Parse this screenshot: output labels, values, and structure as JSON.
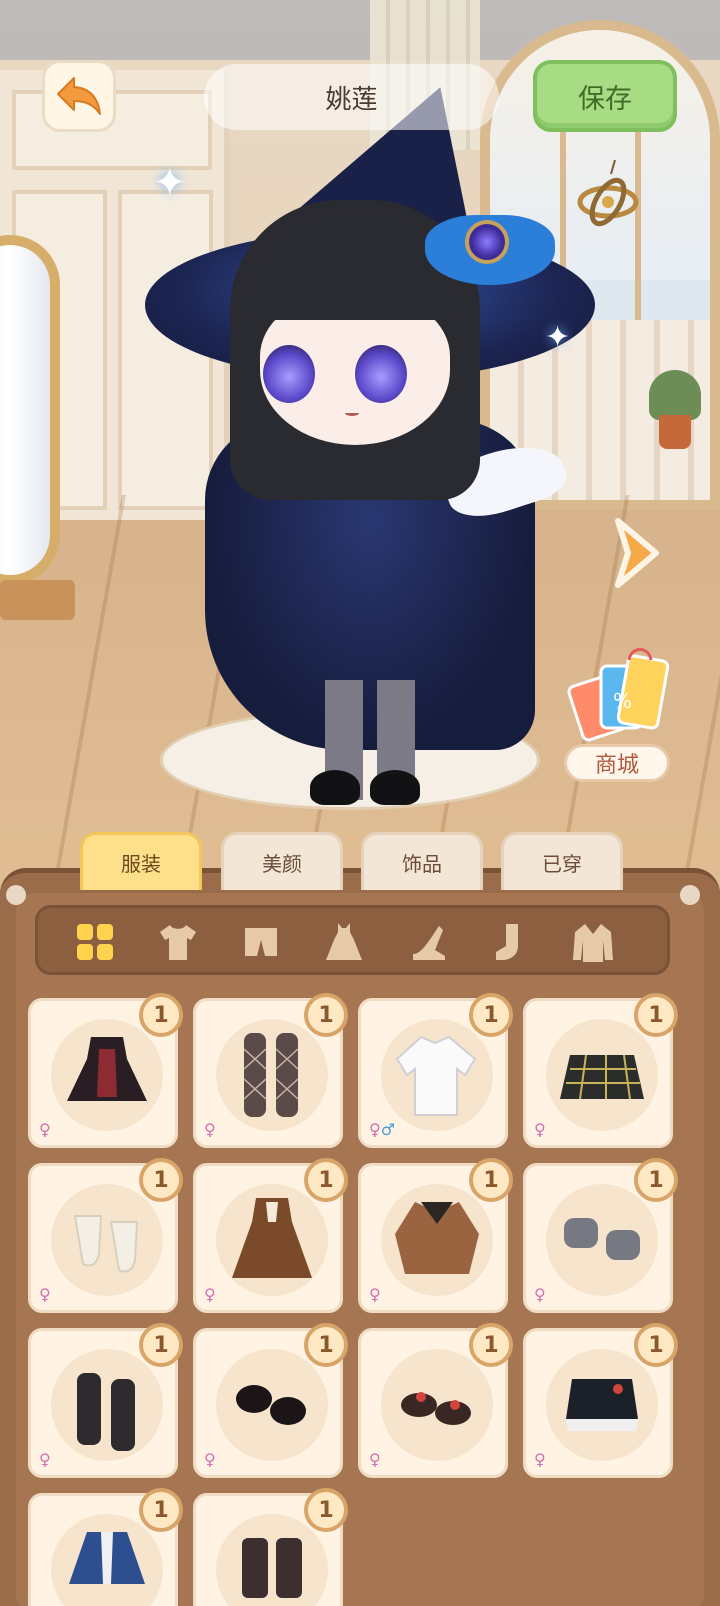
{
  "header": {
    "character_name": "姚莲",
    "save_label": "保存"
  },
  "shop": {
    "label": "商城"
  },
  "tabs": [
    {
      "label": "服装",
      "active": true
    },
    {
      "label": "美颜",
      "active": false
    },
    {
      "label": "饰品",
      "active": false
    },
    {
      "label": "已穿",
      "active": false
    }
  ],
  "categories": [
    {
      "name": "all-icon",
      "active": true
    },
    {
      "name": "top-icon",
      "active": false
    },
    {
      "name": "bottom-icon",
      "active": false
    },
    {
      "name": "dress-icon",
      "active": false
    },
    {
      "name": "shoe-icon",
      "active": false
    },
    {
      "name": "sock-icon",
      "active": false
    },
    {
      "name": "coat-icon",
      "active": false
    }
  ],
  "items": [
    {
      "icon": "gothic-dress-icon",
      "count": "1",
      "gender": "♀"
    },
    {
      "icon": "fishnet-stockings-icon",
      "count": "1",
      "gender": "♀"
    },
    {
      "icon": "white-shirt-icon",
      "count": "1",
      "gender": "♀♂"
    },
    {
      "icon": "plaid-skirt-icon",
      "count": "1",
      "gender": "♀"
    },
    {
      "icon": "white-socks-icon",
      "count": "1",
      "gender": "♀"
    },
    {
      "icon": "brown-dress-icon",
      "count": "1",
      "gender": "♀"
    },
    {
      "icon": "brown-jacket-icon",
      "count": "1",
      "gender": "♀"
    },
    {
      "icon": "gray-boots-icon",
      "count": "1",
      "gender": "♀"
    },
    {
      "icon": "black-stockings-icon",
      "count": "1",
      "gender": "♀"
    },
    {
      "icon": "black-shoes-icon",
      "count": "1",
      "gender": "♀"
    },
    {
      "icon": "bow-shoes-icon",
      "count": "1",
      "gender": "♀"
    },
    {
      "icon": "crop-top-icon",
      "count": "1",
      "gender": "♀"
    },
    {
      "icon": "blue-robe-icon",
      "count": "1",
      "gender": "♀"
    },
    {
      "icon": "dark-boots-icon",
      "count": "1",
      "gender": "♀"
    }
  ],
  "colors": {
    "save_green": "#a8dc84",
    "active_tab": "#ffe08a",
    "panel_brown": "#9a6c4a",
    "back_arrow": "#f39a3d"
  }
}
